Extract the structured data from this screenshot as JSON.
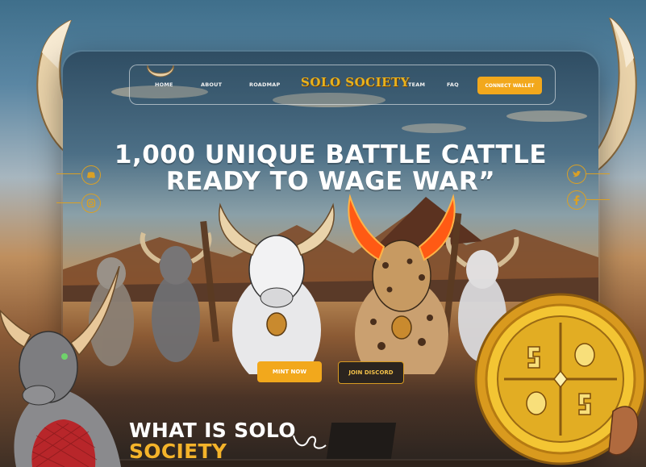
{
  "nav": {
    "home": "HOME",
    "about": "ABOUT",
    "roadmap": "ROADMAP",
    "logo": "SOLO SOCIETY",
    "team": "TEAM",
    "faq": "FAQ",
    "connect_wallet": "CONNECT WALLET"
  },
  "hero": {
    "headline_line1": "1,000 UNIQUE BATTLE CATTLE",
    "headline_line2": "READY TO WAGE WAR”",
    "mint_label": "MINT NOW",
    "discord_label": "JOIN DISCORD"
  },
  "social": {
    "left": [
      "discord-icon",
      "instagram-icon"
    ],
    "right": [
      "twitter-icon",
      "facebook-icon"
    ]
  },
  "section": {
    "title_line1": "WHAT IS SOLO",
    "title_line2": "SOCIETY"
  },
  "colors": {
    "accent": "#f2a81c",
    "accent_dark": "#d79a22",
    "horn": "#e8c89a",
    "fire": "#ff6a1a"
  }
}
